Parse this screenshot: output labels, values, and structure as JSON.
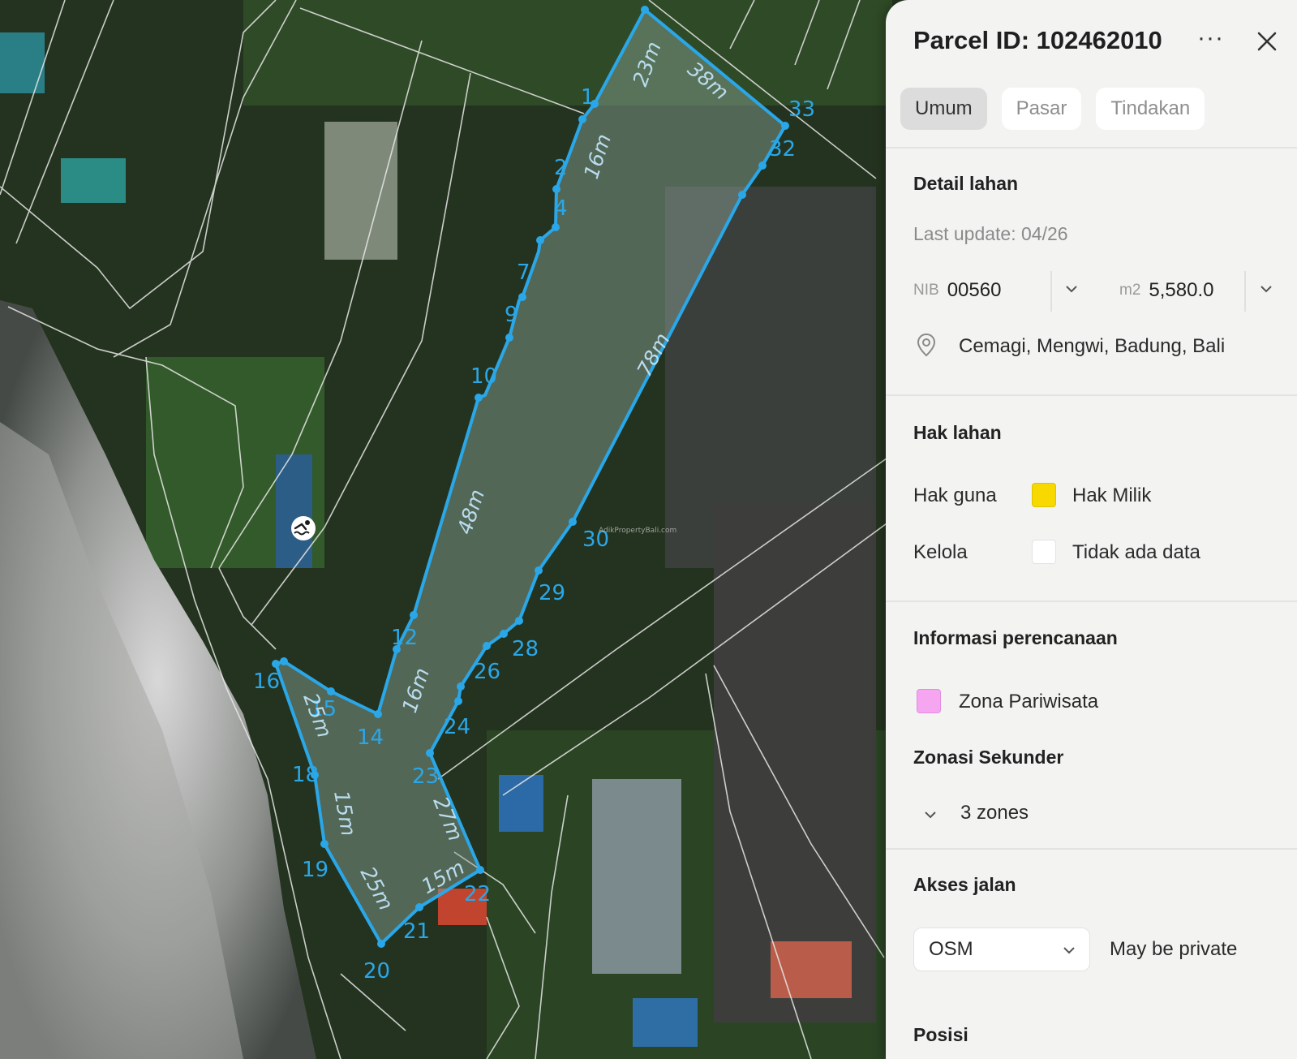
{
  "map": {
    "vertex_labels": [
      "1",
      "2",
      "4",
      "7",
      "9",
      "10",
      "12",
      "14",
      "15",
      "16",
      "18",
      "19",
      "20",
      "21",
      "22",
      "23",
      "24",
      "26",
      "28",
      "29",
      "30",
      "32",
      "33"
    ],
    "edge_lengths": [
      "23m",
      "38m",
      "16m",
      "78m",
      "48m",
      "16m",
      "25m",
      "15m",
      "27m",
      "25m",
      "15m"
    ],
    "watermark": "AdikPropertyBali.com",
    "poi_icon": "swimming-icon",
    "colors": {
      "parcel_stroke": "#2aa7e8",
      "parcel_fill": "#8fa79c"
    }
  },
  "panel": {
    "title": "Parcel ID: 102462010",
    "more_icon": "more-horizontal-icon",
    "close_icon": "close-icon",
    "tabs": [
      "Umum",
      "Pasar",
      "Tindakan"
    ],
    "active_tab": "Umum",
    "land_detail": {
      "heading": "Detail lahan",
      "last_update": "Last update: 04/26",
      "nib_label": "NIB",
      "nib_value": "00560",
      "area_label": "m2",
      "area_value": "5,580.0",
      "location": "Cemagi, Mengwi, Badung, Bali",
      "location_icon": "map-pin-icon"
    },
    "land_rights": {
      "heading": "Hak lahan",
      "hak_guna_label": "Hak guna",
      "hak_guna_value": "Hak Milik",
      "hak_guna_color": "#f7d900",
      "kelola_label": "Kelola",
      "kelola_value": "Tidak ada data",
      "kelola_color": "#ffffff"
    },
    "planning": {
      "heading": "Informasi perencanaan",
      "zone": "Zona Pariwisata",
      "zone_color": "#f6a6f0",
      "secondary_heading": "Zonasi Sekunder",
      "secondary_value": "3 zones"
    },
    "road_access": {
      "heading": "Akses jalan",
      "source": "OSM",
      "note": "May be private"
    },
    "position_heading": "Posisi"
  }
}
